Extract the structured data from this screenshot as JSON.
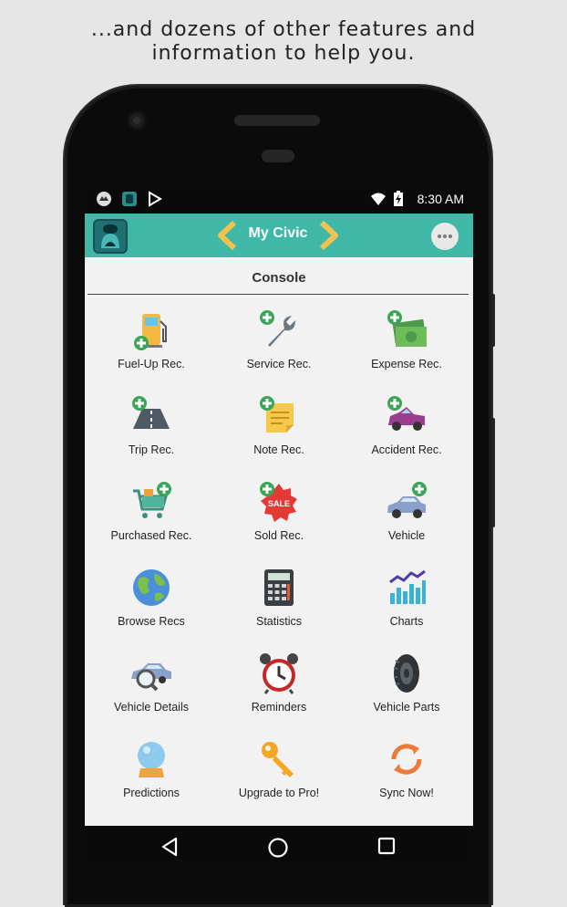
{
  "headline": {
    "line1": "...and dozens of other features and",
    "line2": "information to help you."
  },
  "status_bar": {
    "time": "8:30 AM",
    "icons": [
      "app-notification-icon",
      "app-logo-icon",
      "play-store-icon",
      "wifi-icon",
      "battery-charging-icon"
    ]
  },
  "app_bar": {
    "vehicle_name": "My Civic",
    "prev_icon": "chevron-left-icon",
    "next_icon": "chevron-right-icon",
    "menu_icon": "more-options-icon"
  },
  "console": {
    "title": "Console"
  },
  "tiles": [
    {
      "label": "Fuel-Up Rec.",
      "icon": "fuel-pump-add-icon"
    },
    {
      "label": "Service Rec.",
      "icon": "wrench-add-icon"
    },
    {
      "label": "Expense Rec.",
      "icon": "money-add-icon"
    },
    {
      "label": "Trip Rec.",
      "icon": "road-add-icon"
    },
    {
      "label": "Note Rec.",
      "icon": "note-add-icon"
    },
    {
      "label": "Accident Rec.",
      "icon": "crashed-car-add-icon"
    },
    {
      "label": "Purchased Rec.",
      "icon": "cart-add-icon"
    },
    {
      "label": "Sold Rec.",
      "icon": "sale-tag-add-icon"
    },
    {
      "label": "Vehicle",
      "icon": "car-add-icon"
    },
    {
      "label": "Browse Recs",
      "icon": "globe-icon"
    },
    {
      "label": "Statistics",
      "icon": "calculator-icon"
    },
    {
      "label": "Charts",
      "icon": "bar-chart-icon"
    },
    {
      "label": "Vehicle Details",
      "icon": "car-magnifier-icon"
    },
    {
      "label": "Reminders",
      "icon": "alarm-clock-icon"
    },
    {
      "label": "Vehicle Parts",
      "icon": "tire-icon"
    },
    {
      "label": "Predictions",
      "icon": "crystal-ball-icon"
    },
    {
      "label": "Upgrade to Pro!",
      "icon": "key-icon"
    },
    {
      "label": "Sync Now!",
      "icon": "sync-icon"
    }
  ],
  "nav_bar": {
    "icons": [
      "back-icon",
      "home-icon",
      "recents-icon"
    ]
  },
  "colors": {
    "app_bar": "#3fb8a8",
    "arrow": "#f2c14e",
    "add_badge": "#3aa655",
    "screen_bg": "#f2f2f2"
  }
}
